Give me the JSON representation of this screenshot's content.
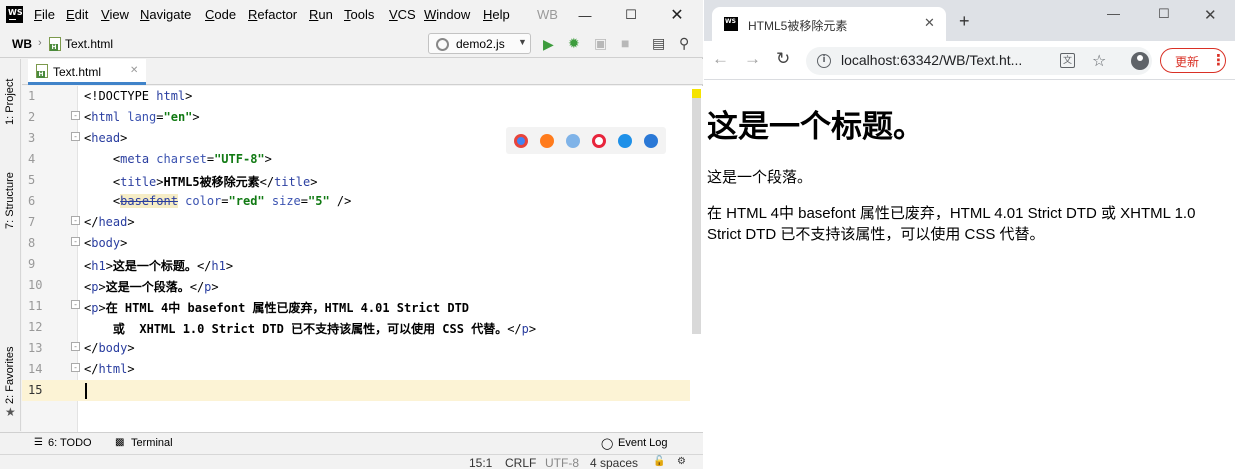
{
  "ide": {
    "logo": "WS",
    "menu": [
      {
        "hot": "F",
        "rest": "ile"
      },
      {
        "hot": "E",
        "rest": "dit"
      },
      {
        "hot": "V",
        "rest": "iew"
      },
      {
        "hot": "N",
        "rest": "avigate"
      },
      {
        "hot": "C",
        "rest": "ode"
      },
      {
        "hot": "R",
        "rest": "efactor"
      },
      {
        "hot": "R",
        "rest": "un"
      },
      {
        "hot": "T",
        "rest": "ools"
      },
      {
        "hot": "V",
        "rest": "CS"
      },
      {
        "hot": "W",
        "rest": "indow"
      },
      {
        "hot": "H",
        "rest": "elp"
      }
    ],
    "project_short": "WB",
    "nav_file": "Text.html",
    "run_config": "demo2.js",
    "tab_label": "Text.html",
    "left_tabs": [
      "1: Project",
      "7: Structure",
      "2: Favorites"
    ],
    "lines": [
      {
        "n": "1",
        "fold": "",
        "html": "<span class=\"brk\">&lt;!DOCTYPE </span><span class=\"tag\">html</span><span class=\"brk\">&gt;</span>"
      },
      {
        "n": "2",
        "fold": "-",
        "html": "<span class=\"brk\">&lt;</span><span class=\"tag\">html </span><span class=\"attr\">lang</span><span class=\"brk\">=</span><span class=\"str\">\"en\"</span><span class=\"brk\">&gt;</span>"
      },
      {
        "n": "3",
        "fold": "-",
        "html": "<span class=\"brk\">&lt;</span><span class=\"tag\">head</span><span class=\"brk\">&gt;</span>"
      },
      {
        "n": "4",
        "fold": "",
        "html": "    <span class=\"brk\">&lt;</span><span class=\"tag\">meta </span><span class=\"attr\">charset</span><span class=\"brk\">=</span><span class=\"str\">\"UTF-8\"</span><span class=\"brk\">&gt;</span>"
      },
      {
        "n": "5",
        "fold": "",
        "html": "    <span class=\"brk\">&lt;</span><span class=\"tag\">title</span><span class=\"brk\">&gt;</span><span class=\"txt\">HTML5被移除元素</span><span class=\"brk\">&lt;/</span><span class=\"tag\">title</span><span class=\"brk\">&gt;</span>"
      },
      {
        "n": "6",
        "fold": "",
        "html": "    <span class=\"brk\">&lt;</span><span class=\"deprecated\">basefont</span><span class=\"attr\"> color</span><span class=\"brk\">=</span><span class=\"str\">\"red\"</span><span class=\"attr\"> size</span><span class=\"brk\">=</span><span class=\"str\">\"5\"</span><span class=\"brk\"> /&gt;</span>"
      },
      {
        "n": "7",
        "fold": "-",
        "html": "<span class=\"brk\">&lt;/</span><span class=\"tag\">head</span><span class=\"brk\">&gt;</span>"
      },
      {
        "n": "8",
        "fold": "-",
        "html": "<span class=\"brk\">&lt;</span><span class=\"tag\">body</span><span class=\"brk\">&gt;</span>"
      },
      {
        "n": "9",
        "fold": "",
        "html": "<span class=\"brk\">&lt;</span><span class=\"tag\">h1</span><span class=\"brk\">&gt;</span><span class=\"txt\">这是一个标题。</span><span class=\"brk\">&lt;/</span><span class=\"tag\">h1</span><span class=\"brk\">&gt;</span>"
      },
      {
        "n": "10",
        "fold": "",
        "html": "<span class=\"brk\">&lt;</span><span class=\"tag\">p</span><span class=\"brk\">&gt;</span><span class=\"txt\">这是一个段落。</span><span class=\"brk\">&lt;/</span><span class=\"tag\">p</span><span class=\"brk\">&gt;</span>"
      },
      {
        "n": "11",
        "fold": "-",
        "html": "<span class=\"brk\">&lt;</span><span class=\"tag\">p</span><span class=\"brk\">&gt;</span><span class=\"txt\">在 HTML 4中 basefont 属性已废弃，HTML 4.01 Strict DTD</span>"
      },
      {
        "n": "12",
        "fold": "",
        "html": "<span class=\"txt\">    或  XHTML 1.0 Strict DTD 已不支持该属性，可以使用 CSS 代替。</span><span class=\"brk\">&lt;/</span><span class=\"tag\">p</span><span class=\"brk\">&gt;</span>"
      },
      {
        "n": "13",
        "fold": "-",
        "html": "<span class=\"brk\">&lt;/</span><span class=\"tag\">body</span><span class=\"brk\">&gt;</span>"
      },
      {
        "n": "14",
        "fold": "-",
        "html": "<span class=\"brk\">&lt;/</span><span class=\"tag\">html</span><span class=\"brk\">&gt;</span>"
      },
      {
        "n": "15",
        "fold": "",
        "html": ""
      }
    ],
    "current_line": 15,
    "bottom_tools": {
      "todo": "6: TODO",
      "terminal": "Terminal",
      "event_log": "Event Log"
    },
    "status": {
      "position": "15:1",
      "line_sep": "CRLF",
      "encoding": "UTF-8",
      "indent": "4 spaces"
    }
  },
  "browser": {
    "tab_title": "HTML5被移除元素",
    "url": "localhost:63342/WB/Text.ht...",
    "update_label": "更新",
    "page": {
      "h1": "这是一个标题。",
      "p1": "这是一个段落。",
      "p2": "在 HTML 4中 basefont 属性已废弃，HTML 4.01 Strict DTD 或 XHTML 1.0 Strict DTD 已不支持该属性，可以使用 CSS 代替。"
    }
  },
  "colors": {
    "accent": "#4083c9",
    "update_red": "#d93025",
    "current_line": "#fcf3d5"
  }
}
